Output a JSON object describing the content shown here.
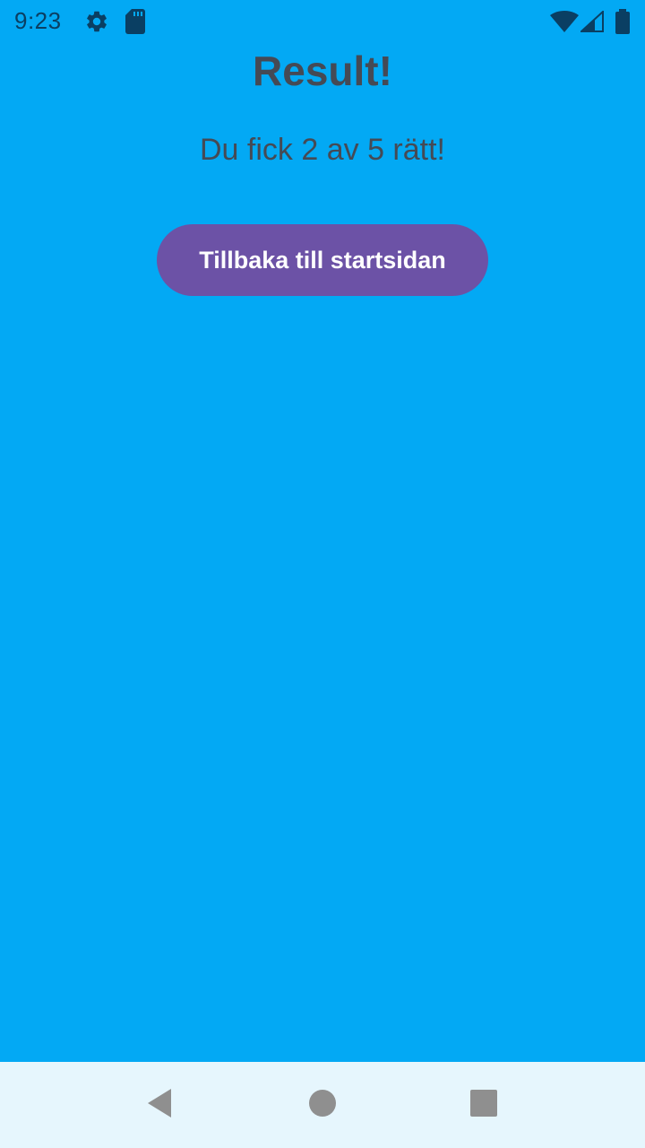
{
  "status_bar": {
    "time": "9:23",
    "icons": [
      "gear-icon",
      "sd-card-icon",
      "wifi-icon",
      "signal-icon",
      "battery-icon"
    ],
    "icon_color": "#0a3f63"
  },
  "main": {
    "title": "Result!",
    "score_text": "Du fick 2 av 5 rätt!",
    "back_button_label": "Tillbaka till startsidan"
  },
  "nav_bar": {
    "icons": [
      "back-icon",
      "home-icon",
      "recents-icon"
    ],
    "icon_color": "#8f8f8f"
  },
  "colors": {
    "background": "#03a9f4",
    "button": "#6c52a6",
    "text": "#454a55",
    "nav_background": "#e6f6fd"
  }
}
